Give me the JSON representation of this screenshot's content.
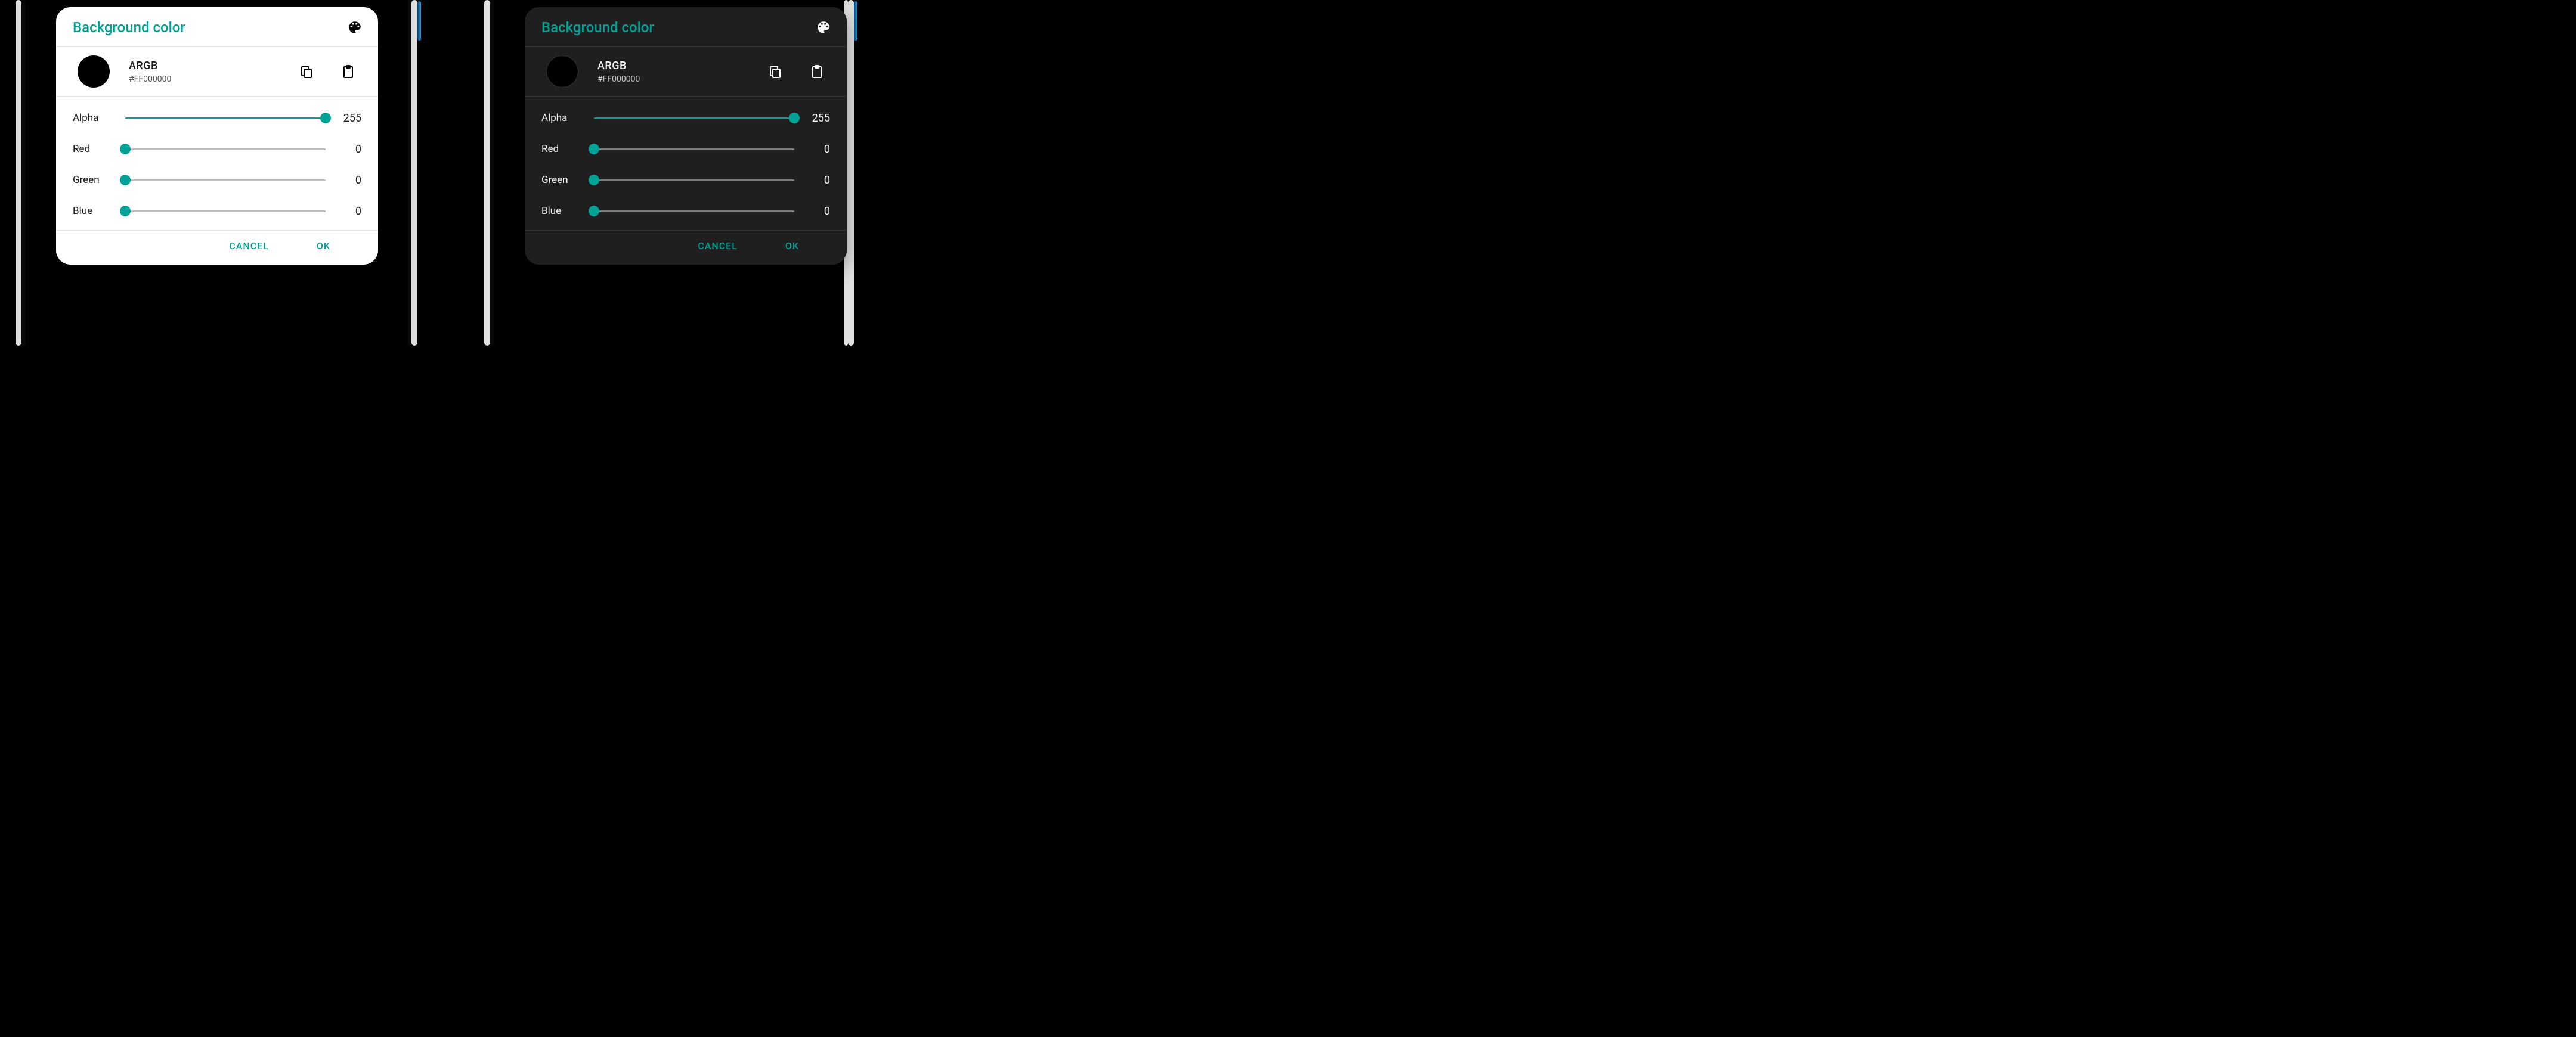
{
  "accent": "#00a197",
  "dialog": {
    "title": "Background color",
    "argb_label": "ARGB",
    "argb_value": "#FF000000",
    "swatch_color": "#000000",
    "sliders": {
      "alpha": {
        "label": "Alpha",
        "value": 255,
        "max": 255
      },
      "red": {
        "label": "Red",
        "value": 0,
        "max": 255
      },
      "green": {
        "label": "Green",
        "value": 0,
        "max": 255
      },
      "blue": {
        "label": "Blue",
        "value": 0,
        "max": 255
      }
    },
    "buttons": {
      "cancel": "CANCEL",
      "ok": "OK"
    },
    "icons": {
      "palette": "palette-icon",
      "copy": "copy-icon",
      "paste": "clipboard-icon"
    }
  },
  "themes": {
    "light": {
      "bg": "#ffffff",
      "fg": "#1b1b1b",
      "divider": "#e4e4e4",
      "track": "#bdbdbd"
    },
    "dark": {
      "bg": "#1f1f1f",
      "fg": "#f2f2f2",
      "divider": "#333333",
      "track": "#7c7c7c"
    }
  }
}
